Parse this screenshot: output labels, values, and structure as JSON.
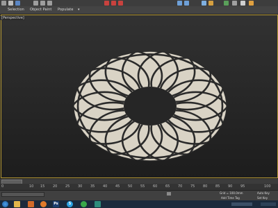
{
  "ribbon": {
    "tabs": [
      "Selection",
      "Object Paint",
      "Populate"
    ]
  },
  "viewport": {
    "label": "[Perspective]"
  },
  "timeline": {
    "ticks": [
      "0",
      "10",
      "15",
      "20",
      "25",
      "30",
      "35",
      "40",
      "45",
      "50",
      "55",
      "60",
      "65",
      "70",
      "75",
      "80",
      "85",
      "90",
      "95",
      "100"
    ]
  },
  "status": {
    "grid": "Grid = 100.0mm",
    "add_time_tag": "Add Time Tag",
    "auto_key": "Auto Key",
    "set_key": "Set Key"
  },
  "colors": {
    "viewport_frame": "#b79a34",
    "pattern_fill": "#d9d3c5",
    "pattern_lines": "#2a2a2a",
    "taskbar": "#1b2a3c"
  },
  "icons": {
    "taskbar": [
      "start-orb-icon",
      "explorer-icon",
      "media-icon",
      "firefox-icon",
      "photoshop-icon",
      "skype-icon",
      "chrome-icon",
      "3dsmax-icon"
    ]
  }
}
